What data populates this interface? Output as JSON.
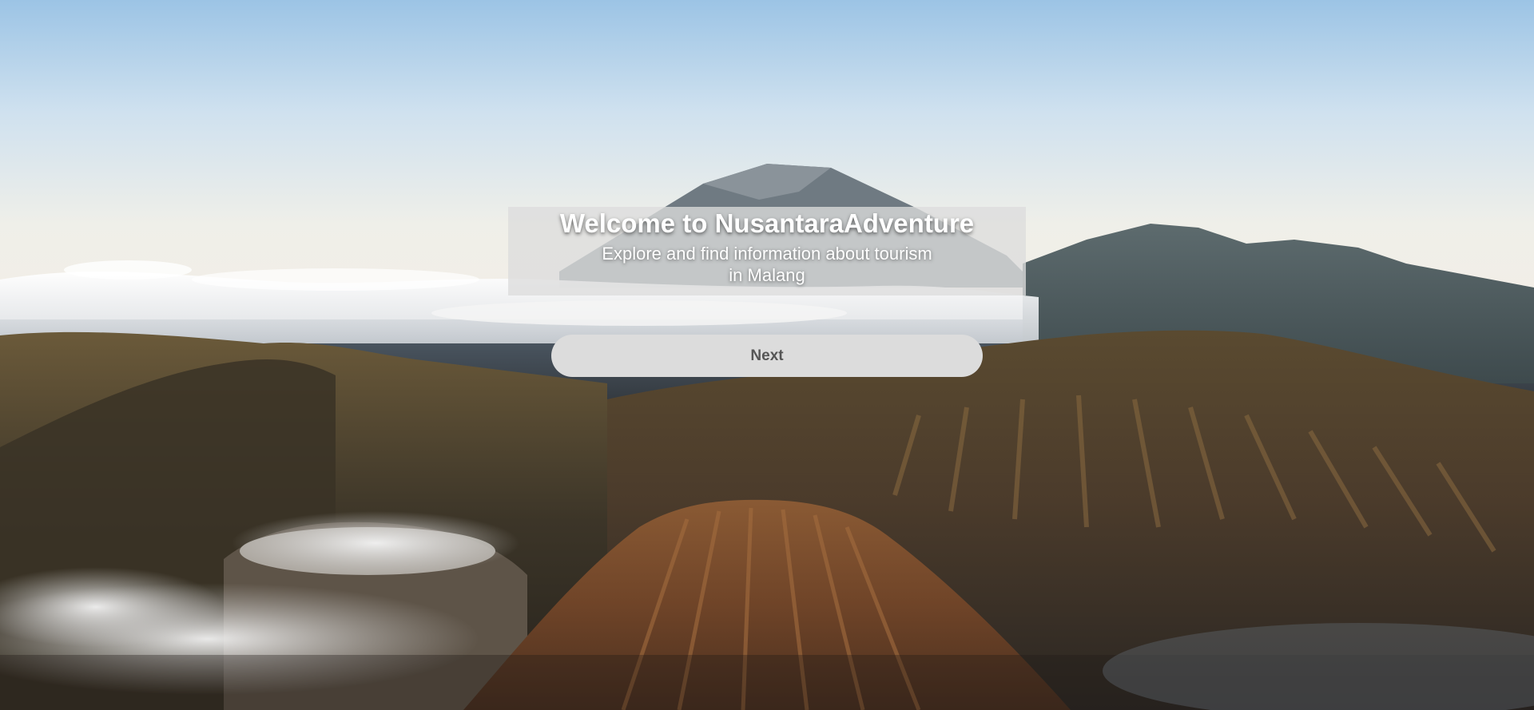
{
  "app": {
    "brand": "NusantaraAdventure"
  },
  "hero": {
    "title": "Welcome to NusantaraAdventure",
    "subtitle": "Explore and find information about tourism in Malang",
    "background": "volcanic-mountains-landscape-image"
  },
  "actions": {
    "next_label": "Next"
  },
  "colors": {
    "panel_overlay": "#dcdcdc",
    "button_bg": "#dcdcdc",
    "button_text": "#555555",
    "title_text": "#ffffff"
  }
}
